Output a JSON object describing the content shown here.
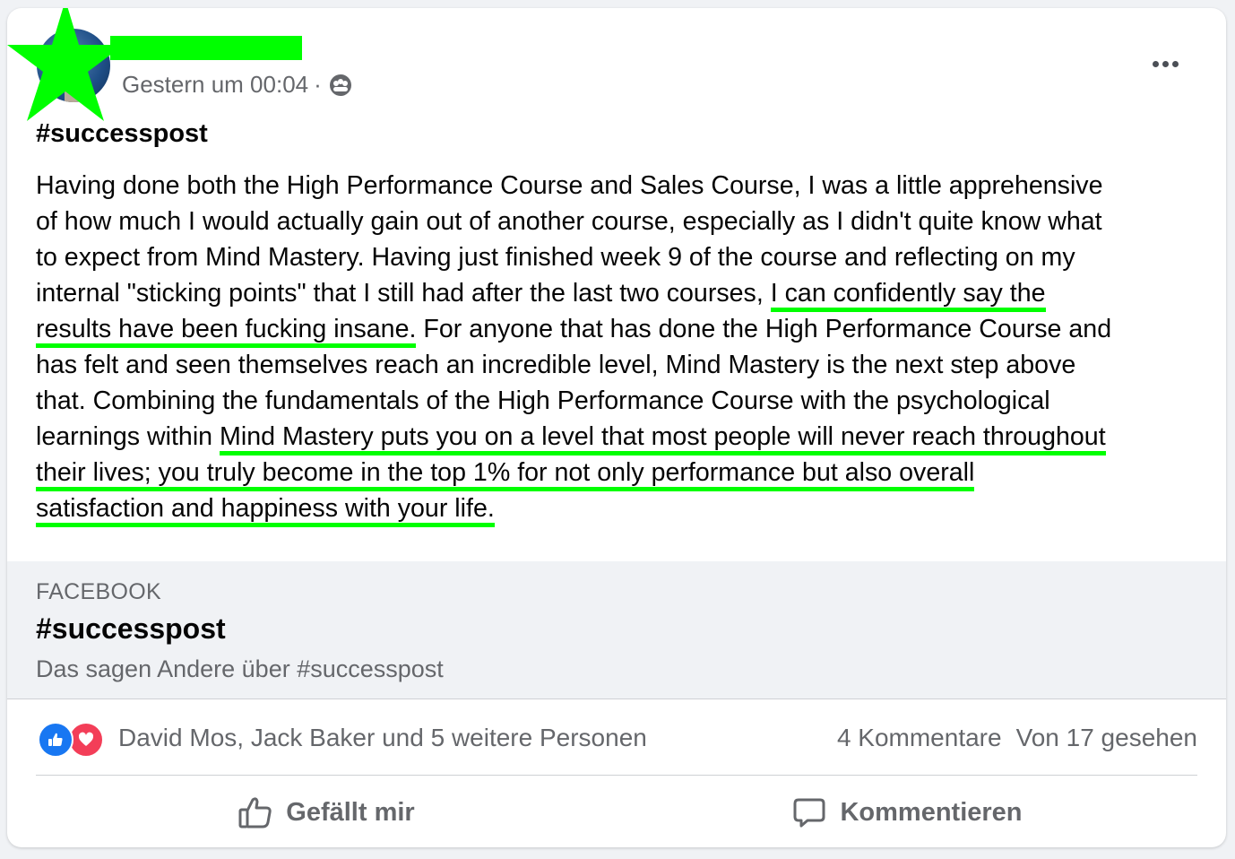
{
  "post": {
    "timestamp": "Gestern um 00:04",
    "separator": "·",
    "privacy_icon": "group-icon",
    "more_icon": "more-options-icon",
    "hashtag": "#successpost",
    "body": {
      "l1": "Having done both the High Performance Course and Sales Course, I was a little apprehensive",
      "l2": "of how much I would actually gain out of another course, especially as I didn't quite know what",
      "l3": "to expect from Mind Mastery. Having just finished week 9 of the course and reflecting on my",
      "l4a": "internal \"sticking points\" that I still had after the last two courses, ",
      "l4b": "I can confidently say the",
      "l5a": "results have been fucking insane.",
      "l5b": " For anyone that has done the High Performance Course and",
      "l6": "has felt and seen themselves reach an incredible level, Mind Mastery is the next step above",
      "l7": "that. Combining the fundamentals of the High Performance Course with the psychological",
      "l8a": "learnings within ",
      "l8b": "Mind Mastery puts you on a level that most people will never reach throughout",
      "l9": "their lives; you truly become in the top 1% for not only performance but also overall",
      "l10": "satisfaction and happiness with your life."
    },
    "highlight_color": "#00ff00"
  },
  "link_preview": {
    "source": "FACEBOOK",
    "title": "#successpost",
    "subtitle": "Das sagen Andere über #successpost"
  },
  "reactions": {
    "icons": [
      "like-icon",
      "love-icon"
    ],
    "names": "David Mos, Jack Baker und 5 weitere Personen",
    "comments": "4 Kommentare",
    "seen": "Von 17 gesehen"
  },
  "actions": {
    "like_label": "Gefällt mir",
    "comment_label": "Kommentieren"
  },
  "colors": {
    "secondary_text": "#65676b",
    "primary_text": "#050505",
    "like_blue": "#1877f2",
    "love_red": "#f33e58"
  }
}
